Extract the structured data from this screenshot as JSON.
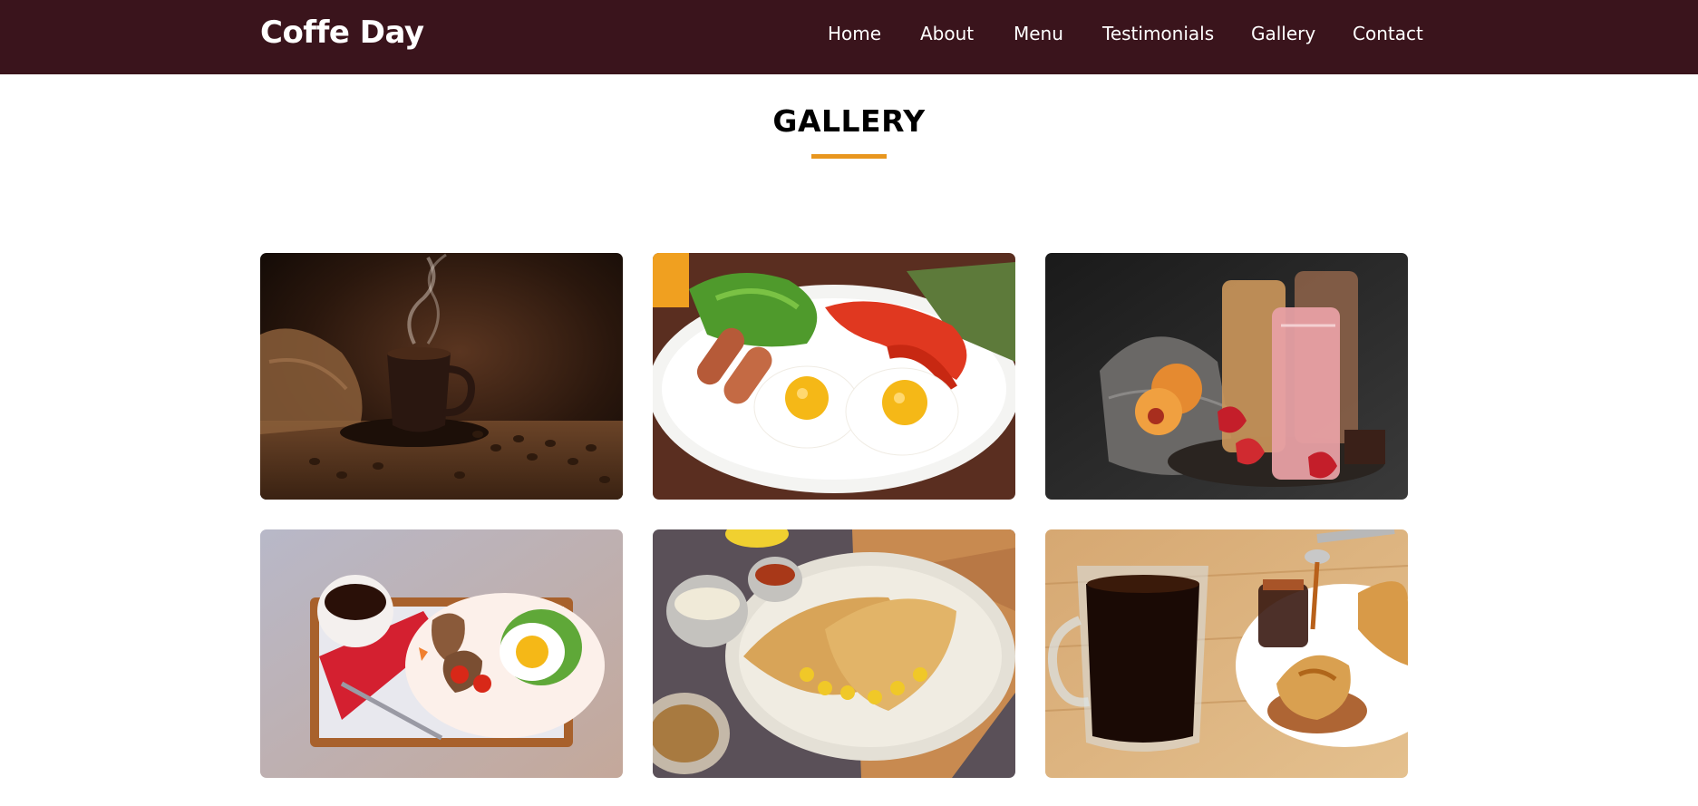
{
  "header": {
    "brand": "Coffe Day",
    "nav": {
      "home": "Home",
      "about": "About",
      "menu": "Menu",
      "testimonials": "Testimonials",
      "gallery": "Gallery",
      "contact": "Contact"
    }
  },
  "gallery": {
    "title": "GALLERY",
    "accent_color": "#e8961e",
    "images": [
      {
        "subject": "steaming-coffee-cup-with-beans"
      },
      {
        "subject": "fried-eggs-sausages-peppers-plate"
      },
      {
        "subject": "smoothie-glasses-with-fruit"
      },
      {
        "subject": "breakfast-tray-coffee-egg-toast"
      },
      {
        "subject": "dosa-with-chutneys"
      },
      {
        "subject": "black-coffee-glass-and-croissant"
      }
    ]
  },
  "theme": {
    "navbar_bg": "#3a141c",
    "nav_text": "#ffffff"
  }
}
